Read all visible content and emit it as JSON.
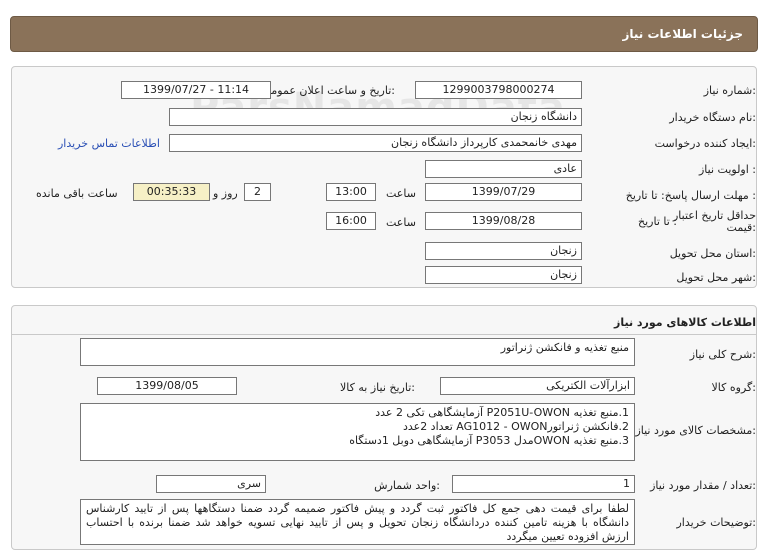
{
  "header": {
    "title": "جزئیات اطلاعات نیاز"
  },
  "form": {
    "need_number": {
      "label": "شماره نیاز:",
      "value": "1299003798000274"
    },
    "announce_datetime": {
      "label": "تاریخ و ساعت اعلان عمومی:",
      "value": "1399/07/27 - 11:14"
    },
    "buyer_org": {
      "label": "نام دستگاه خریدار:",
      "value": "دانشگاه زنجان"
    },
    "requester": {
      "label": "ایجاد کننده درخواست:",
      "value": "مهدی خانمحمدی کارپرداز دانشگاه زنجان"
    },
    "contact_link": "اطلاعات تماس خریدار",
    "priority": {
      "label": "اولویت نیاز :",
      "value": "عادی"
    },
    "reply_deadline": {
      "label": "مهلت ارسال پاسخ: تا تاریخ :",
      "date": "1399/07/29",
      "time_label": "ساعت",
      "time": "13:00",
      "days": "2",
      "days_label": "روز و",
      "remaining": "00:35:33",
      "remaining_label": "ساعت باقی مانده"
    },
    "price_validity": {
      "label_line1": "حداقل تاریخ اعتبار",
      "label_line2": "قیمت:",
      "to_date_label": "تا تاریخ :",
      "date": "1399/08/28",
      "time_label": "ساعت",
      "time": "16:00"
    },
    "delivery_province": {
      "label": "استان محل تحویل:",
      "value": "زنجان"
    },
    "delivery_city": {
      "label": "شهر محل تحویل:",
      "value": "زنجان"
    }
  },
  "goods": {
    "section_title": "اطلاعات کالاهای مورد نیاز",
    "summary": {
      "label": "شرح کلی نیاز:",
      "value": "منبع تغذیه و فانکشن ژنراتور"
    },
    "group": {
      "label": "گروه کالا:",
      "value": "ابزارآلات الکتریکی"
    },
    "need_date": {
      "label": "تاریخ نیاز به کالا:",
      "value": "1399/08/05"
    },
    "specs": {
      "label": "مشخصات کالای مورد نیاز:",
      "lines": [
        "1.منبع تغذیه P2051U-OWON آزمایشگاهی تکی 2 عدد",
        "2.فانکشن ژنراتورAG1012 - OWON تعداد 2عدد",
        "3.منبع تغذیه OWONمدل P3053 آزمایشگاهی دوبل 1دستگاه"
      ]
    },
    "quantity": {
      "label": "تعداد / مقدار مورد نیاز:",
      "value": "1"
    },
    "unit": {
      "label": "واحد شمارش:",
      "value": "سری"
    },
    "buyer_notes": {
      "label": "توضیحات خریدار:",
      "text": "لطفا برای قیمت دهی جمع کل فاکتور ثبت گردد و پیش فاکتور ضمیمه گردد ضمنا دستگاهها پس از تایید کارشناس دانشگاه با هزینه تامین کننده دردانشگاه زنجان تحویل و پس از تایید نهایی تسویه خواهد شد ضمنا برنده با احتساب ارزش افزوده تعیین میگردد"
    }
  },
  "watermark": "ParsNamadData"
}
